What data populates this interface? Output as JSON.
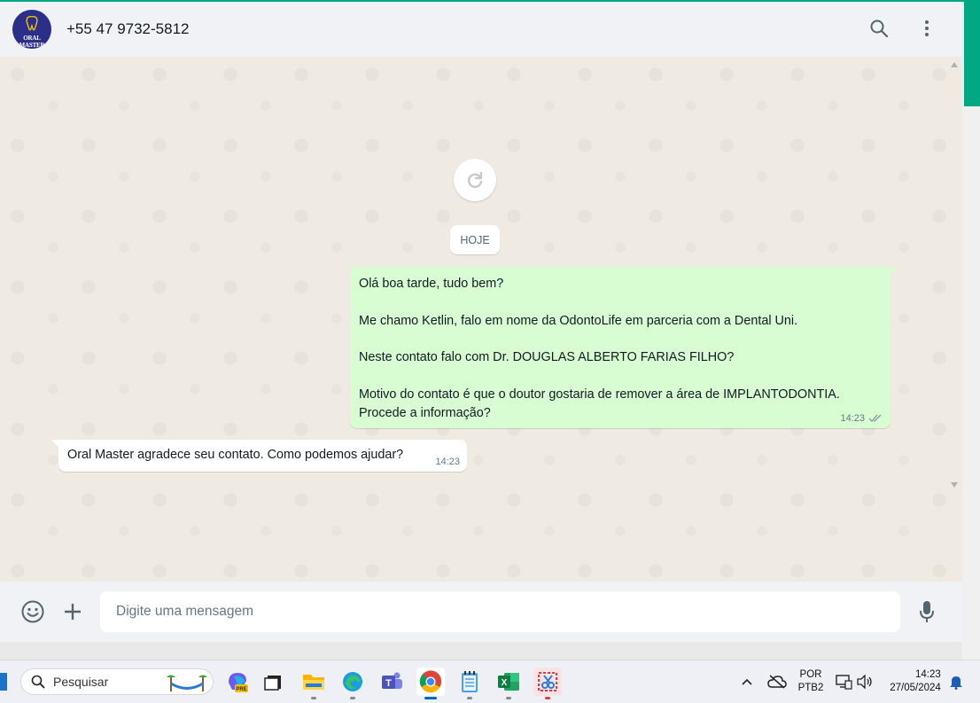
{
  "header": {
    "avatar_brand": "ORAL MASTER",
    "contact_name": "+55 47 9732-5812",
    "icons": [
      "search-icon",
      "menu-dots-icon"
    ]
  },
  "chat": {
    "date_chip": "HOJE",
    "outgoing": {
      "lines": [
        "Olá boa tarde, tudo bem?",
        "Me chamo Ketlin, falo em nome da OdontoLife em parceria com a Dental Uni.",
        "Neste contato falo com Dr. DOUGLAS ALBERTO FARIAS FILHO?",
        "Motivo do contato é que o doutor gostaria de remover a área de IMPLANTODONTIA.",
        "Procede a informação?"
      ],
      "time": "14:23",
      "status": "double-check-icon"
    },
    "incoming": {
      "text": "Oral Master agradece seu contato. Como podemos ajudar?",
      "time": "14:23"
    }
  },
  "footer": {
    "placeholder": "Digite uma mensagem",
    "icons": [
      "emoji-icon",
      "plus-icon",
      "microphone-icon"
    ]
  },
  "taskbar": {
    "search_label": "Pesquisar",
    "apps": [
      "copilot-icon",
      "taskview-icon",
      "file-explorer-icon",
      "edge-icon",
      "teams-icon",
      "chrome-icon",
      "notepad-icon",
      "excel-icon",
      "snipping-tool-icon"
    ],
    "lang_top": "POR",
    "lang_bottom": "PTB2",
    "time": "14:23",
    "date": "27/05/2024"
  },
  "colors": {
    "accent": "#00a884",
    "chat_bg": "#efeae2",
    "outgoing_bubble": "#d9fdd3",
    "header_bg": "#f0f2f5"
  }
}
